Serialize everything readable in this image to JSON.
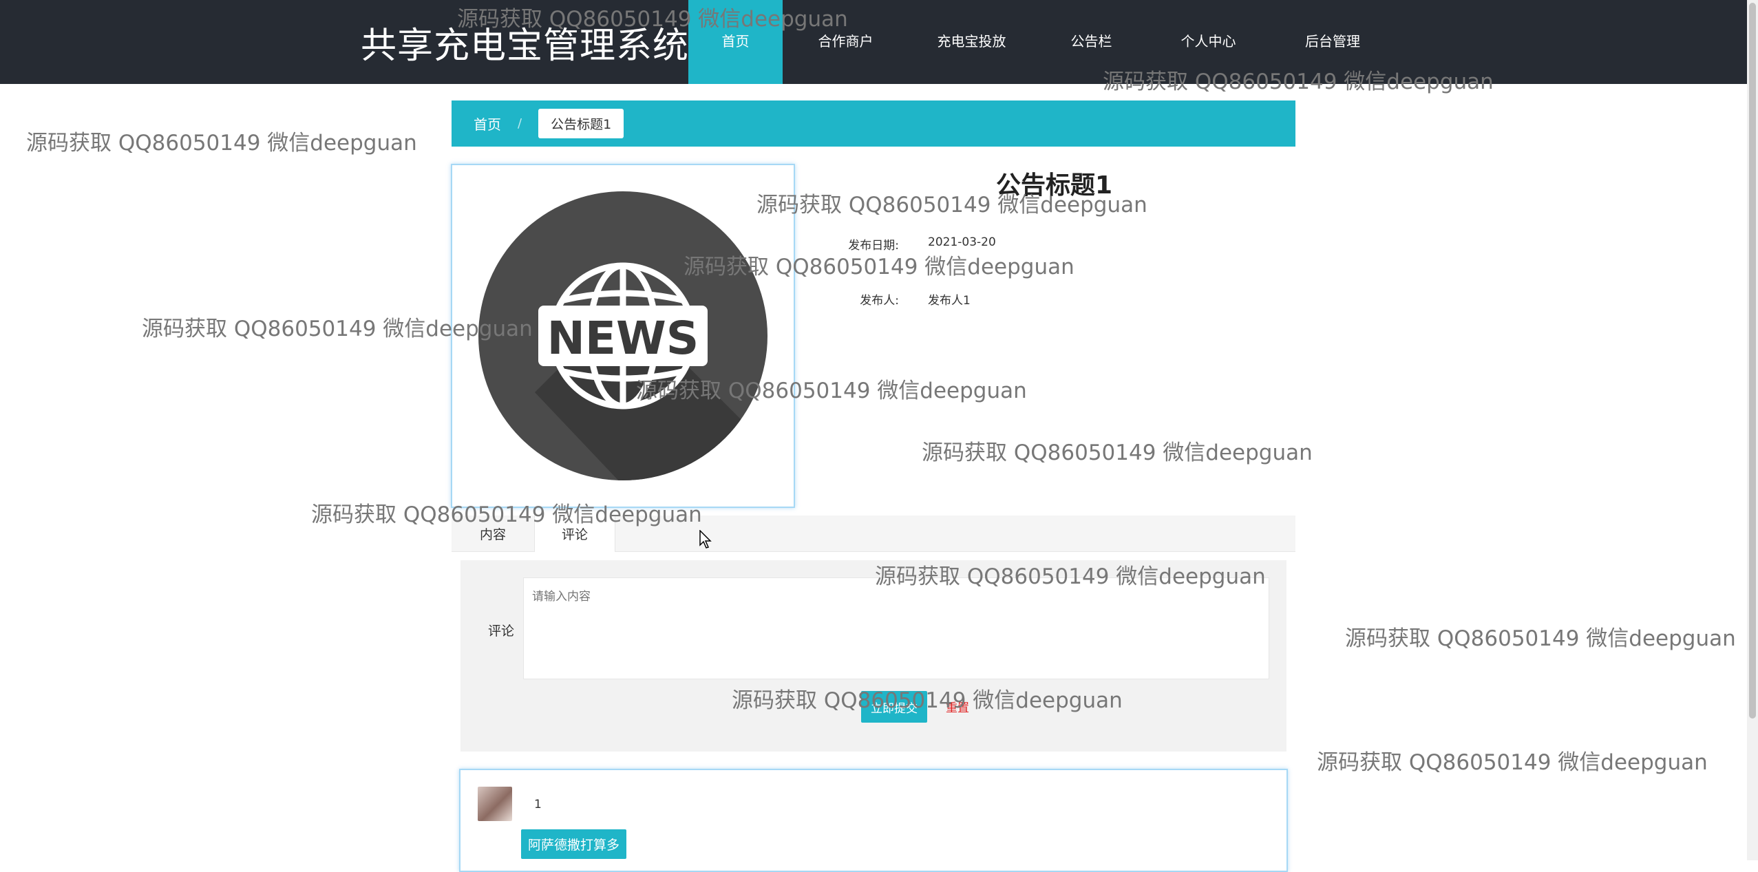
{
  "header": {
    "site_title": "共享充电宝管理系统",
    "nav": [
      {
        "label": "首页",
        "active": true
      },
      {
        "label": "合作商户"
      },
      {
        "label": "充电宝投放"
      },
      {
        "label": "公告栏"
      },
      {
        "label": "个人中心"
      },
      {
        "label": "后台管理"
      }
    ]
  },
  "breadcrumb": {
    "home": "首页",
    "separator": "/",
    "current": "公告标题1"
  },
  "image": {
    "text": "NEWS",
    "icon": "globe-icon"
  },
  "detail": {
    "title": "公告标题1",
    "date_label": "发布日期:",
    "date_value": "2021-03-20",
    "publisher_label": "发布人:",
    "publisher_value": "发布人1"
  },
  "tabs": [
    {
      "label": "内容"
    },
    {
      "label": "评论",
      "active": true
    }
  ],
  "comment_form": {
    "label": "评论",
    "placeholder": "请输入内容",
    "submit_label": "立即提交",
    "reset_label": "重置"
  },
  "comments": [
    {
      "text": "1",
      "reply_tag": "阿萨德撒打算多"
    }
  ],
  "watermark": "源码获取 QQ86050149 微信deepguan",
  "colors": {
    "header_bg": "#262b33",
    "accent": "#1fb5c8",
    "reset": "#e02020"
  }
}
